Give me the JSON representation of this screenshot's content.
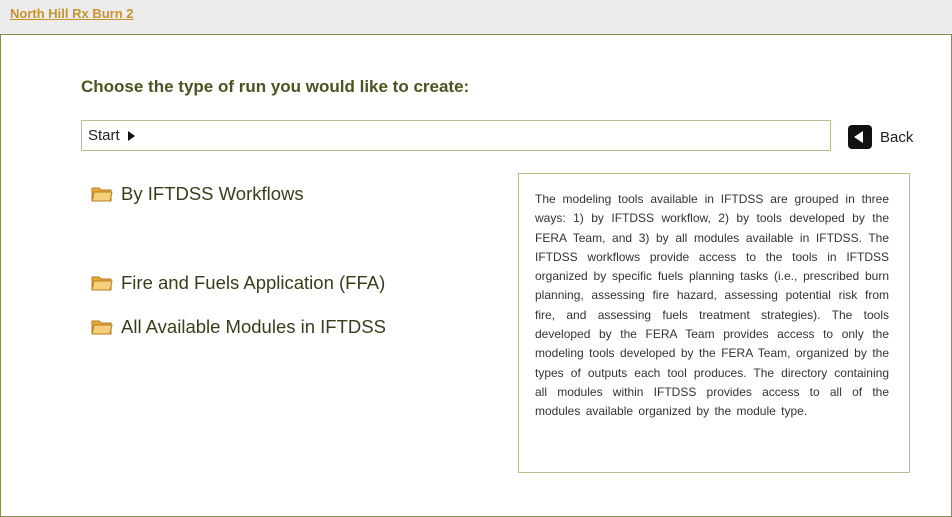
{
  "project": {
    "title": "North Hill Rx Burn 2"
  },
  "main": {
    "heading": "Choose the type of run you would like to create:",
    "breadcrumb": {
      "start_label": "Start"
    },
    "back_label": "Back",
    "options": [
      {
        "label": "By IFTDSS Workflows",
        "icon": "folder-icon"
      },
      {
        "label": "Fire and Fuels Application (FFA)",
        "icon": "folder-icon"
      },
      {
        "label": "All Available Modules in IFTDSS",
        "icon": "folder-icon"
      }
    ],
    "info_text": "The modeling tools available in IFTDSS are grouped in three ways: 1) by IFTDSS workflow, 2) by tools developed by the FERA Team, and 3) by all modules available in IFTDSS. The IFTDSS workflows provide access to the tools in IFTDSS organized by specific fuels planning tasks (i.e., prescribed burn planning, assessing fire hazard, assessing potential risk from fire, and assessing fuels treatment strategies). The tools developed by the FERA Team provides access to only the modeling tools developed by the FERA Team, organized by the types of outputs each tool produces. The directory containing all modules within IFTDSS provides access to all of the modules available organized by the module type."
  },
  "colors": {
    "heading": "#4b5320",
    "link": "#c8932a",
    "panel_border": "#8a8a55",
    "folder": "#f0b64a"
  }
}
